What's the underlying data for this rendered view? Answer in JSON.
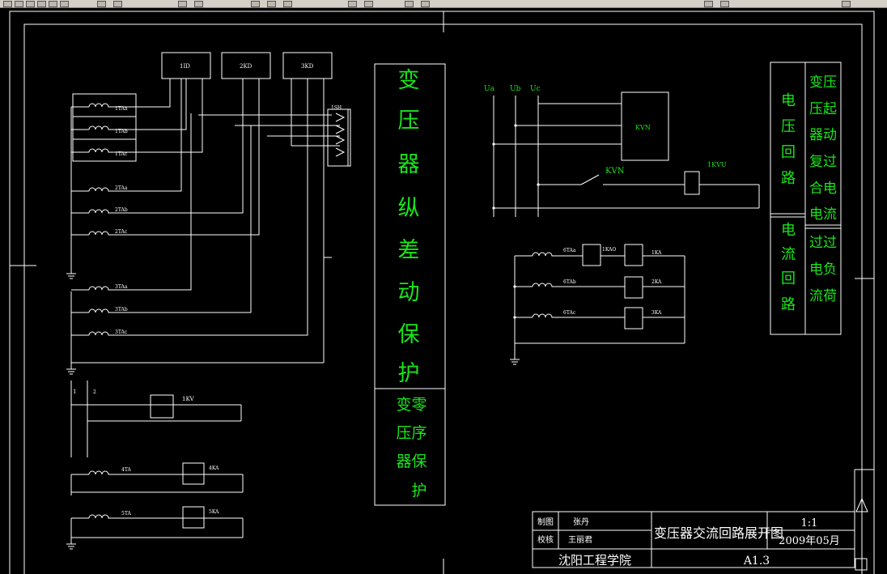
{
  "title_block": {
    "drawing_title": "变压器交流回路展开图",
    "drafter_label": "制图",
    "drafter_name": "张丹",
    "checker_label": "校核",
    "checker_name": "王丽君",
    "school": "沈阳工程学院",
    "scale": "1:1",
    "date": "2009年05月",
    "sheet": "A1.3"
  },
  "center_box": {
    "main_chars": [
      "变",
      "压",
      "器",
      "纵",
      "差",
      "动",
      "保",
      "护"
    ],
    "sub_col1": [
      "变",
      "压",
      "器"
    ],
    "sub_col2": [
      "零",
      "序",
      "保",
      "护"
    ]
  },
  "right_table": {
    "voltage_loop": [
      "电",
      "压",
      "回",
      "路"
    ],
    "current_loop": [
      "电",
      "流",
      "回",
      "路"
    ],
    "right_top_rows": [
      "变压",
      "压起",
      "器动",
      "复过",
      "合电",
      "电流"
    ],
    "right_bottom_rows": [
      "过过",
      "电负",
      "流荷"
    ]
  },
  "components": {
    "relays_top": [
      "1ID",
      "2KD",
      "3KD"
    ],
    "left_ct": [
      "1TAa",
      "1TAb",
      "1TAc",
      "2TAa",
      "2TAb",
      "2TAc",
      "3TAa",
      "3TAb",
      "3TAc"
    ],
    "switch": "1SH",
    "voltage_bus": [
      "Ua",
      "Ub",
      "Uc"
    ],
    "kvn_box": "KVN",
    "kvn_contact": "KVN",
    "kvu": "1KVU",
    "right_ct": [
      "6TAa",
      "6TAb",
      "6TAc"
    ],
    "right_relays": [
      "1KA",
      "2KA",
      "3KA"
    ],
    "kac": "1KAO",
    "lower_lines": [
      "1",
      "2"
    ],
    "kv_relay": "1KV",
    "ct4": "4TA",
    "ka4": "4KA",
    "ct5": "5TA",
    "ka5": "5KA"
  }
}
